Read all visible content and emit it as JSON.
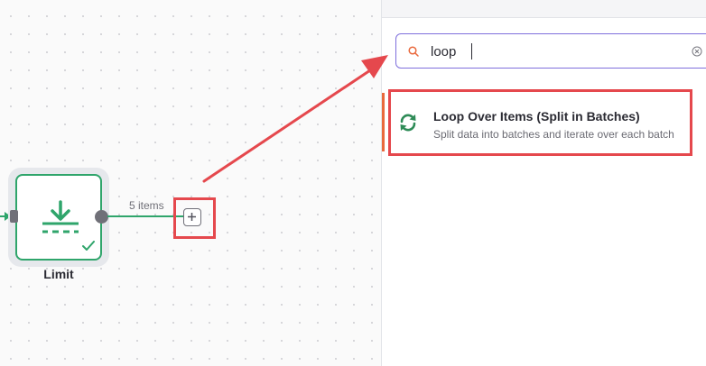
{
  "canvas": {
    "node": {
      "label": "Limit",
      "icon": "download-limit-icon",
      "status_icon": "checkmark-icon",
      "accent_color": "#2fa56b"
    },
    "connection": {
      "items_label": "5 items",
      "add_icon": "plus-icon"
    }
  },
  "node_panel": {
    "search": {
      "value": "loop",
      "placeholder": "",
      "icon": "search-icon",
      "clear_icon": "clear-circle-icon"
    },
    "results": [
      {
        "title": "Loop Over Items (Split in Batches)",
        "description": "Split data into batches and iterate over each batch",
        "icon": "refresh-loop-icon",
        "icon_color": "#2e8b57"
      }
    ]
  },
  "annotations": {
    "highlight_color": "#e5484d"
  }
}
